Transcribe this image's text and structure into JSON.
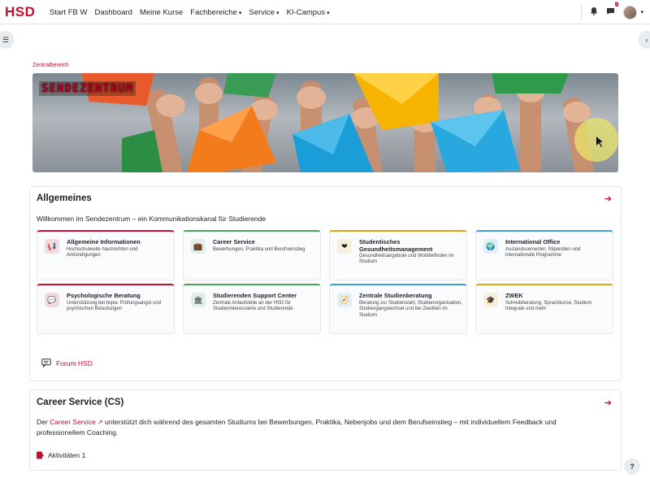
{
  "nav": {
    "logo": "HSD",
    "links": [
      "Start FB W",
      "Dashboard",
      "Meine Kurse"
    ],
    "dropdowns": [
      "Fachbereiche",
      "Service",
      "KI-Campus"
    ],
    "message_badge": "2"
  },
  "breadcrumb": "Zentralbereich",
  "banner": {
    "title": "SENDEZENTRUM"
  },
  "allgemeines": {
    "title": "Allgemeines",
    "intro": "Willkommen im Sendezentrum – ein Kommunikationskanal für Studierende",
    "cards": [
      {
        "title": "Allgemeine Informationen",
        "desc": "Hochschulweite Nachrichten und Ankündigungen",
        "icon": "megaphone-icon",
        "color": "#c4102e",
        "glyph": "📢"
      },
      {
        "title": "Career Service",
        "desc": "Bewerbungen, Praktika und Berufseinstieg",
        "icon": "briefcase-icon",
        "color": "#4aa35a",
        "glyph": "💼"
      },
      {
        "title": "Studentisches Gesundheitsmanagement",
        "desc": "Gesundheitsangebote und Wohlbefinden im Studium",
        "icon": "heart-icon",
        "color": "#d9a412",
        "glyph": "❤"
      },
      {
        "title": "International Office",
        "desc": "Auslandssemester, Stipendien und internationale Programme",
        "icon": "globe-icon",
        "color": "#3aa0d6",
        "glyph": "🌍"
      },
      {
        "title": "Psychologische Beratung",
        "desc": "Unterstützung bei bspw. Prüfungsangst und psychischen Belastungen",
        "icon": "chat-bubble-icon",
        "color": "#c4102e",
        "glyph": "💬"
      },
      {
        "title": "Studierenden Support Center",
        "desc": "Zentrale Anlaufstelle an der HSD für Studieninteressierte und Studierende",
        "icon": "building-icon",
        "color": "#4aa35a",
        "glyph": "🏛"
      },
      {
        "title": "Zentrale Studienberatung",
        "desc": "Beratung zur Studienwahl, Studienorganisation, Studiengangwechsel und bei Zweifeln im Studium",
        "icon": "compass-icon",
        "color": "#3aa0d6",
        "glyph": "🧭"
      },
      {
        "title": "ZWEK",
        "desc": "Schreibberatung, Sprachkurse, Studium Integrale und mehr",
        "icon": "graduation-cap-icon",
        "color": "#d9a412",
        "glyph": "🎓"
      }
    ],
    "forum_label": "Forum HSD"
  },
  "career": {
    "title": "Career Service (CS)",
    "text_before": "Der ",
    "link": "Career Service",
    "text_after": " unterstützt dich während des gesamten Studiums bei Bewerbungen, Praktika, Nebenjobs und dem Berufseinstieg – mit individuellem Feedback und professionellem Coaching.",
    "activities": "Aktivitäten 1"
  },
  "help": "?"
}
